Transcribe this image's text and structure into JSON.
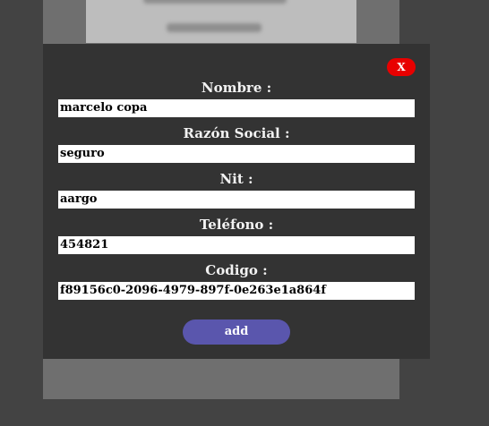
{
  "dialog": {
    "close_label": "X",
    "add_label": "add",
    "colors": {
      "overlay": "#434343",
      "modal_bg": "#333333",
      "close_button": "#e80000",
      "add_button": "#5a56ad",
      "label_text": "#f2f2f2"
    },
    "fields": [
      {
        "label": "Nombre :",
        "value": "marcelo copa"
      },
      {
        "label": "Razón Social :",
        "value": "seguro"
      },
      {
        "label": "Nit :",
        "value": "aargo"
      },
      {
        "label": "Teléfono :",
        "value": "454821"
      },
      {
        "label": "Codigo :",
        "value": "f89156c0-2096-4979-897f-0e263e1a864f"
      }
    ]
  }
}
